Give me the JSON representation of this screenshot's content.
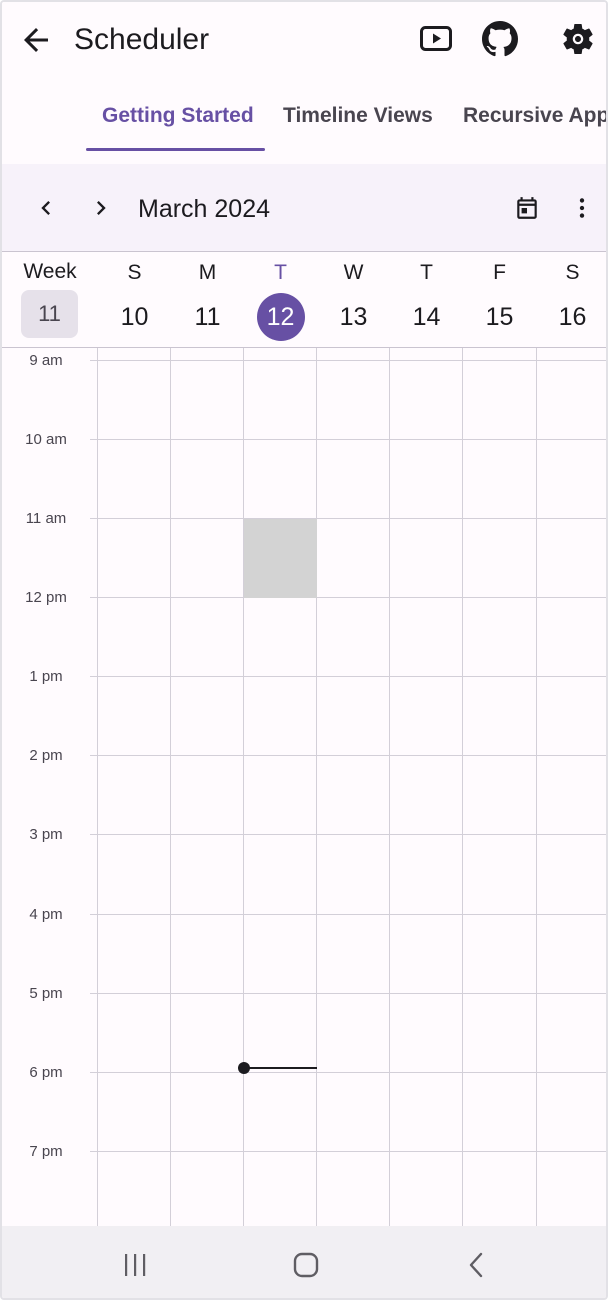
{
  "app": {
    "title": "Scheduler"
  },
  "icons": {
    "back": "arrow-back-icon",
    "youtube": "youtube-icon",
    "github": "github-icon",
    "settings": "gear-icon",
    "prev": "chevron-left-icon",
    "next": "chevron-right-icon",
    "today": "calendar-icon",
    "more": "more-vert-icon"
  },
  "tabs": [
    {
      "label": "Getting Started",
      "active": true
    },
    {
      "label": "Timeline Views",
      "active": false
    },
    {
      "label": "Recursive Appo",
      "active": false
    }
  ],
  "header": {
    "month": "March 2024"
  },
  "week": {
    "label": "Week",
    "number": "11",
    "days": [
      {
        "name": "S",
        "date": "10"
      },
      {
        "name": "M",
        "date": "11"
      },
      {
        "name": "T",
        "date": "12",
        "today": true
      },
      {
        "name": "W",
        "date": "13"
      },
      {
        "name": "T",
        "date": "14"
      },
      {
        "name": "F",
        "date": "15"
      },
      {
        "name": "S",
        "date": "16"
      }
    ]
  },
  "timeline": {
    "hours": [
      "9 am",
      "10 am",
      "11 am",
      "12 pm",
      "1 pm",
      "2 pm",
      "3 pm",
      "4 pm",
      "5 pm",
      "6 pm",
      "7 pm"
    ]
  },
  "colors": {
    "accent": "#6750a4",
    "header_bg": "#f7f2fa",
    "selection": "#d3d3d3"
  }
}
